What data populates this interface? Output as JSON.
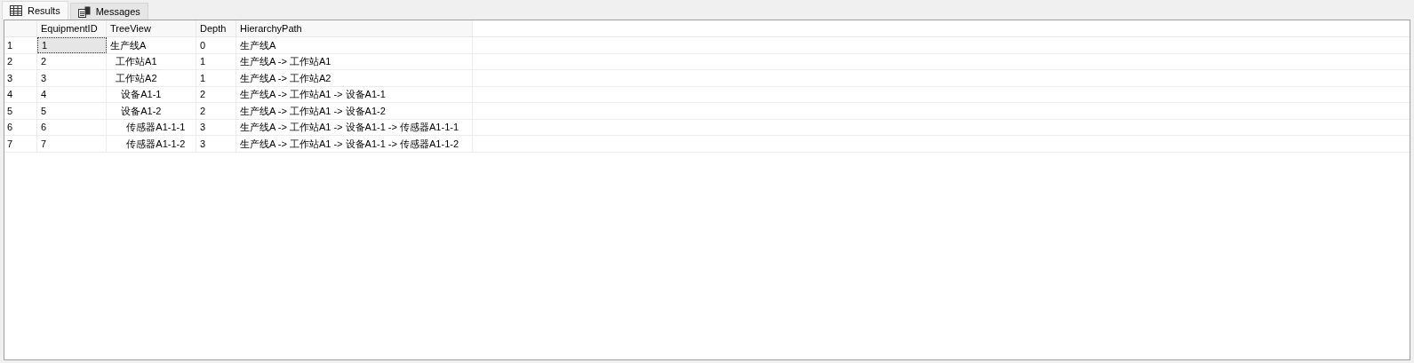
{
  "tabs": [
    {
      "label": "Results",
      "kind": "grid",
      "selected": true
    },
    {
      "label": "Messages",
      "kind": "messages",
      "selected": false
    }
  ],
  "table": {
    "columns": [
      "EquipmentID",
      "TreeView",
      "Depth",
      "HierarchyPath"
    ],
    "rows": [
      {
        "number": "1",
        "cells": [
          "1",
          "生产线A",
          "0",
          "生产线A"
        ],
        "selected": true
      },
      {
        "number": "2",
        "cells": [
          "2",
          "  工作站A1",
          "1",
          "生产线A -> 工作站A1"
        ],
        "selected": false
      },
      {
        "number": "3",
        "cells": [
          "3",
          "  工作站A2",
          "1",
          "生产线A -> 工作站A2"
        ],
        "selected": false
      },
      {
        "number": "4",
        "cells": [
          "4",
          "    设备A1-1",
          "2",
          "生产线A -> 工作站A1 -> 设备A1-1"
        ],
        "selected": false
      },
      {
        "number": "5",
        "cells": [
          "5",
          "    设备A1-2",
          "2",
          "生产线A -> 工作站A1 -> 设备A1-2"
        ],
        "selected": false
      },
      {
        "number": "6",
        "cells": [
          "6",
          "      传感器A1-1-1",
          "3",
          "生产线A -> 工作站A1 -> 设备A1-1 -> 传感器A1-1-1"
        ],
        "selected": false
      },
      {
        "number": "7",
        "cells": [
          "7",
          "      传感器A1-1-2",
          "3",
          "生产线A -> 工作站A1 -> 设备A1-1 -> 传感器A1-1-2"
        ],
        "selected": false
      }
    ]
  }
}
